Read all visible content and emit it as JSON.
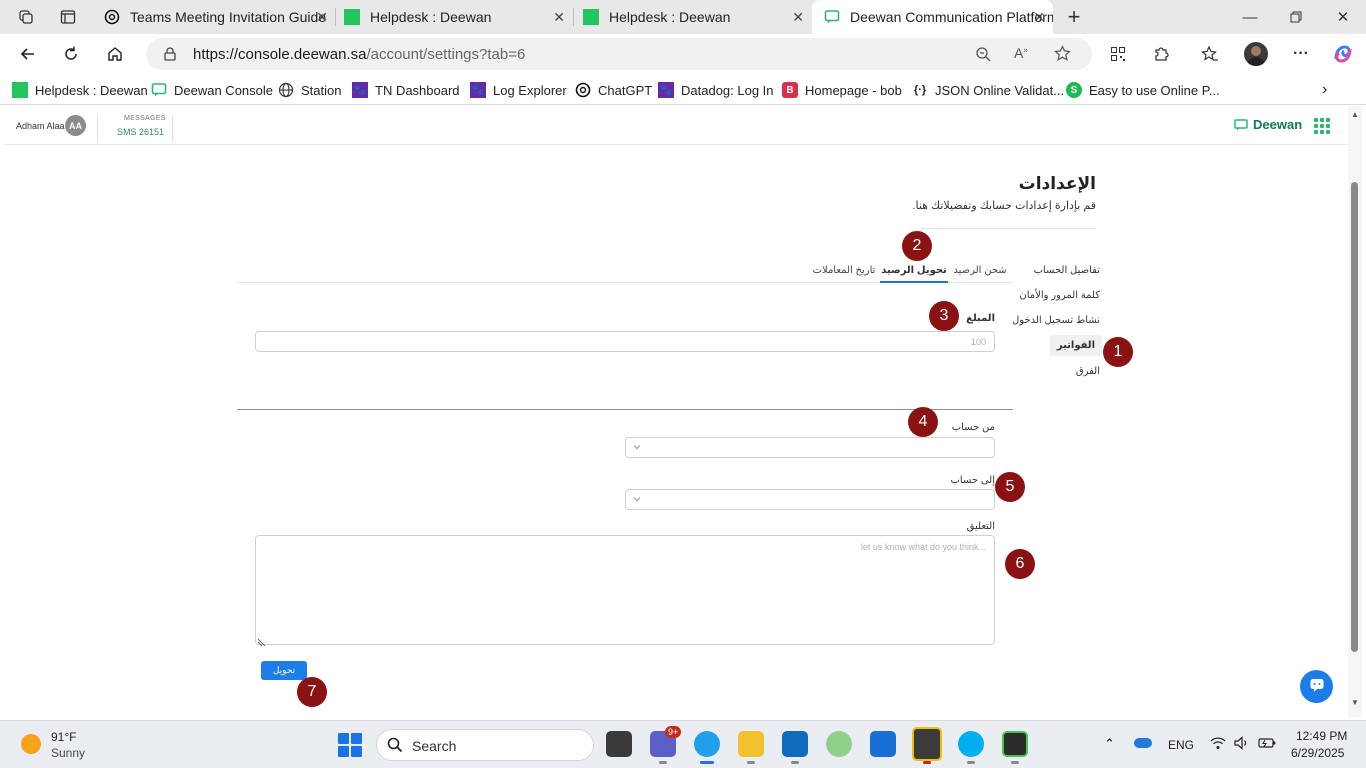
{
  "browser": {
    "tabs": [
      {
        "title": "Teams Meeting Invitation Guide",
        "favicon": "chatgpt-icon"
      },
      {
        "title": "Helpdesk : Deewan",
        "favicon": "helpdesk-icon"
      },
      {
        "title": "Helpdesk : Deewan",
        "favicon": "helpdesk-icon"
      },
      {
        "title": "Deewan Communication Platform",
        "favicon": "deewan-icon",
        "active": true
      }
    ],
    "url_host": "https://console.deewan.sa",
    "url_path": "/account/settings?tab=6",
    "bookmarks": [
      {
        "label": "Helpdesk : Deewan",
        "icon": "helpdesk-icon"
      },
      {
        "label": "Deewan Console",
        "icon": "deewan-icon"
      },
      {
        "label": "Station",
        "icon": "globe-icon"
      },
      {
        "label": "TN Dashboard",
        "icon": "datadog-icon"
      },
      {
        "label": "Log Explorer",
        "icon": "datadog-icon"
      },
      {
        "label": "ChatGPT",
        "icon": "chatgpt-icon"
      },
      {
        "label": "Datadog: Log In",
        "icon": "datadog-icon"
      },
      {
        "label": "Homepage - bob",
        "icon": "b-icon"
      },
      {
        "label": "JSON Online Validat...",
        "icon": "json-icon"
      },
      {
        "label": "Easy to use Online P...",
        "icon": "s-icon"
      }
    ]
  },
  "header": {
    "user_name": "Adham Alaa",
    "user_initials": "AA",
    "messages_label": "MESSAGES",
    "messages_value": "SMS 26151",
    "brand": "Deewan"
  },
  "settings": {
    "title": "الإعدادات",
    "subtitle": "قم بإدارة إعدادات حسابك وتفضيلاتك هنا.",
    "sidebar": [
      {
        "label": "تفاصيل الحساب"
      },
      {
        "label": "كلمة المرور والأمان"
      },
      {
        "label": "نشاط تسجيل الدخول"
      },
      {
        "label": "الفواتير",
        "active": true
      },
      {
        "label": "الفرق"
      }
    ],
    "tabs": [
      {
        "label": "شحن الرصيد"
      },
      {
        "label": "تحويل الرصيد",
        "active": true
      },
      {
        "label": "تاريخ المعاملات"
      }
    ],
    "form": {
      "amount_label": "المبلغ",
      "amount_placeholder": "100",
      "from_label": "من حساب",
      "to_label": "إلى حساب",
      "comment_label": "التعليق",
      "comment_placeholder": "let us know what do you think...",
      "submit_label": "تحويل"
    },
    "markers": [
      "1",
      "2",
      "3",
      "4",
      "5",
      "6",
      "7"
    ]
  },
  "taskbar": {
    "temperature": "91°F",
    "condition": "Sunny",
    "search_placeholder": "Search",
    "teams_badge": "9+",
    "language": "ENG",
    "time": "12:49 PM",
    "date": "6/29/2025"
  },
  "colors": {
    "accent": "#1c7ce8",
    "brand_green": "#0f7a53",
    "marker": "#8b1212"
  }
}
